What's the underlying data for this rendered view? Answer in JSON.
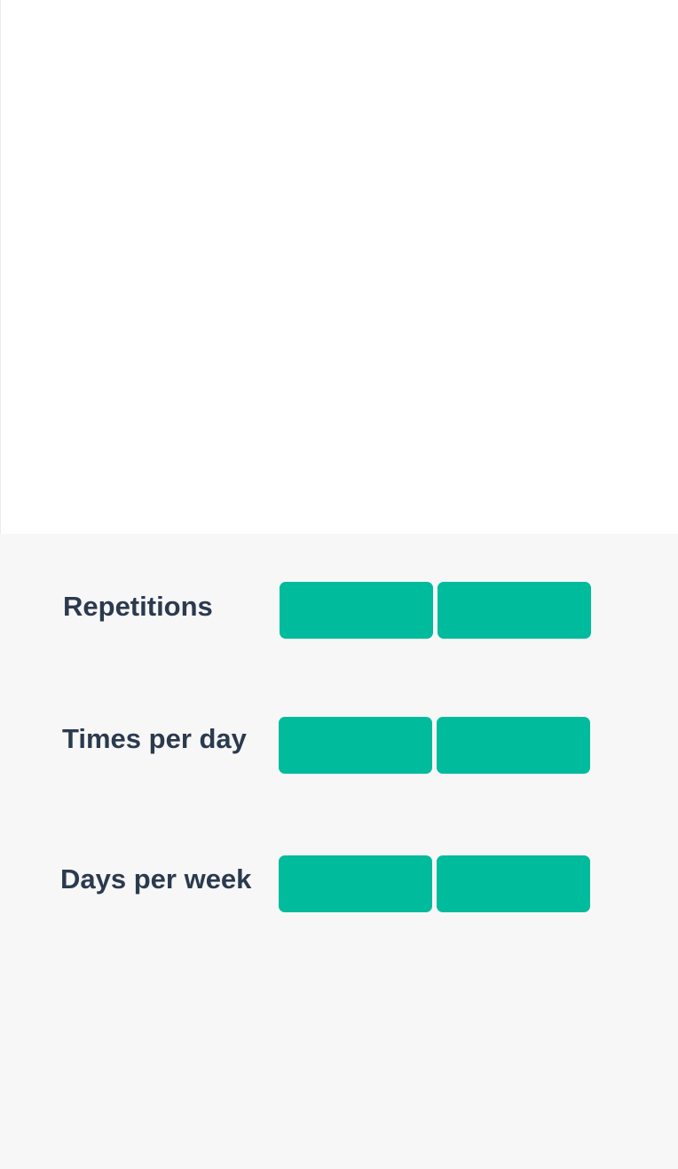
{
  "theme": {
    "button_color": "#00bb9c",
    "label_color": "#2b3a4e",
    "panel_background": "#f7f7f7",
    "top_background": "#ffffff"
  },
  "rows": [
    {
      "label": "Repetitions"
    },
    {
      "label": "Times per day"
    },
    {
      "label": "Days per week"
    }
  ]
}
